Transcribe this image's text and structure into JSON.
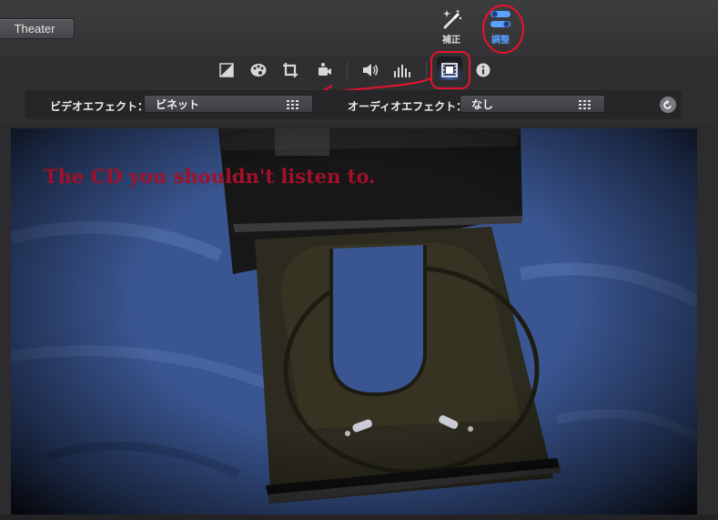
{
  "toolbar": {
    "theater_label": "Theater",
    "enhance_label": "補正",
    "adjust_label": "調整"
  },
  "inspector": {
    "icons": [
      "color-balance-icon",
      "color-palette-icon",
      "crop-icon",
      "stabilization-icon",
      "volume-icon",
      "equalizer-icon",
      "clip-filter-icon",
      "info-icon"
    ],
    "video_effect_label": "ビデオエフェクト：",
    "video_effect_value": "ビネット",
    "audio_effect_label": "オーディオエフェクト：",
    "audio_effect_value": "なし"
  },
  "viewer": {
    "title_text": "The CD you shouldn't listen to."
  },
  "colors": {
    "accent_blue": "#5aa0ff",
    "annotation_red": "#e8122e",
    "title_red": "#a3102a"
  }
}
